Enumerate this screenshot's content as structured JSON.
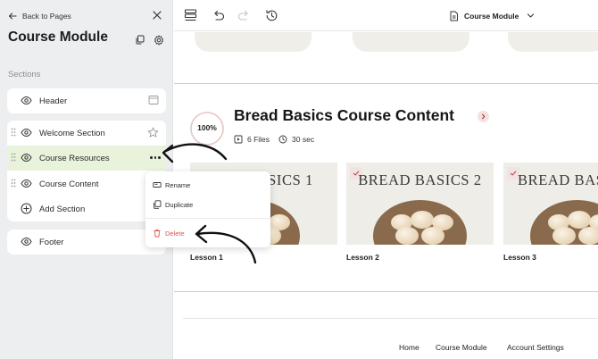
{
  "sidebar": {
    "back_label": "Back to Pages",
    "title": "Course Module",
    "sections_label": "Sections",
    "items": [
      {
        "label": "Header"
      },
      {
        "label": "Welcome Section"
      },
      {
        "label": "Course Resources"
      },
      {
        "label": "Course Content"
      }
    ],
    "add_section_label": "Add Section",
    "footer_label": "Footer",
    "active_item": "Course Resources"
  },
  "context_menu": {
    "rename_label": "Rename",
    "duplicate_label": "Duplicate",
    "delete_label": "Delete"
  },
  "topbar": {
    "module_select": "Course Module"
  },
  "course": {
    "progress_label": "100%",
    "progress_value": 100,
    "title": "Bread Basics Course Content",
    "files": "6 Files",
    "duration": "30 sec",
    "lessons": [
      {
        "image_text": "BASICS 1",
        "label": "Lesson 1"
      },
      {
        "image_text": "BREAD BASICS 2",
        "label": "Lesson 2"
      },
      {
        "image_text": "BREAD BASICS",
        "label": "Lesson 3"
      }
    ]
  },
  "footer_nav": {
    "home": "Home",
    "course_module": "Course Module",
    "account_settings": "Account Settings"
  },
  "colors": {
    "sidebar_bg": "#eceeef",
    "active_row": "#e9f3db",
    "section_border": "#c8dcb0",
    "delete_red": "#e05555",
    "lesson_bg": "#eeede7"
  }
}
